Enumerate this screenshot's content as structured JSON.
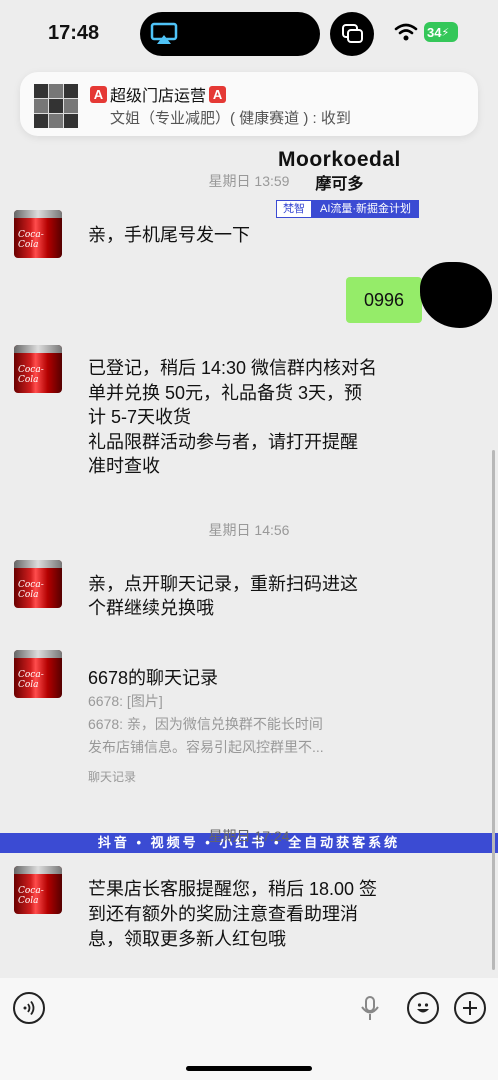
{
  "status": {
    "time": "17:48",
    "battery": "34"
  },
  "notification": {
    "title": "超级门店运营",
    "badge": "A",
    "body": "文姐（专业减肥）( 健康赛道 ) : 收到"
  },
  "watermark": {
    "brand_en": "Moorkoedal",
    "brand_cn": "摩可多",
    "tag_left": "梵智",
    "tag_right": "AI流量·新掘金计划"
  },
  "messages": [
    {
      "type": "time",
      "text": "星期日 13:59"
    },
    {
      "type": "text",
      "text": "亲，手机尾号发一下"
    },
    {
      "type": "self",
      "text": "0996"
    },
    {
      "type": "text",
      "lines": [
        "已登记，稍后 14:30 微信群内核对名",
        "单并兑换 50元，礼品备货 3天，预",
        "计 5-7天收货",
        "礼品限群活动参与者，请打开提醒",
        "准时查收"
      ]
    },
    {
      "type": "time",
      "text": "星期日 14:56"
    },
    {
      "type": "text",
      "lines": [
        "亲，点开聊天记录，重新扫码进这",
        "个群继续兑换哦"
      ]
    },
    {
      "type": "card",
      "title": "6678的聊天记录",
      "lines": [
        "6678: [图片]",
        "6678: 亲，因为微信兑换群不能长时间",
        "发布店铺信息。容易引起风控群里不..."
      ],
      "footer": "聊天记录"
    },
    {
      "type": "time",
      "text": "星期日 17:24"
    },
    {
      "type": "text",
      "lines": [
        "芒果店长客服提醒您，稍后 18.00 签",
        "到还有额外的奖励注意查看助理消",
        "息，领取更多新人红包哦"
      ]
    }
  ],
  "banner": "抖音 • 视频号 • 小红书 • 全自动获客系统"
}
